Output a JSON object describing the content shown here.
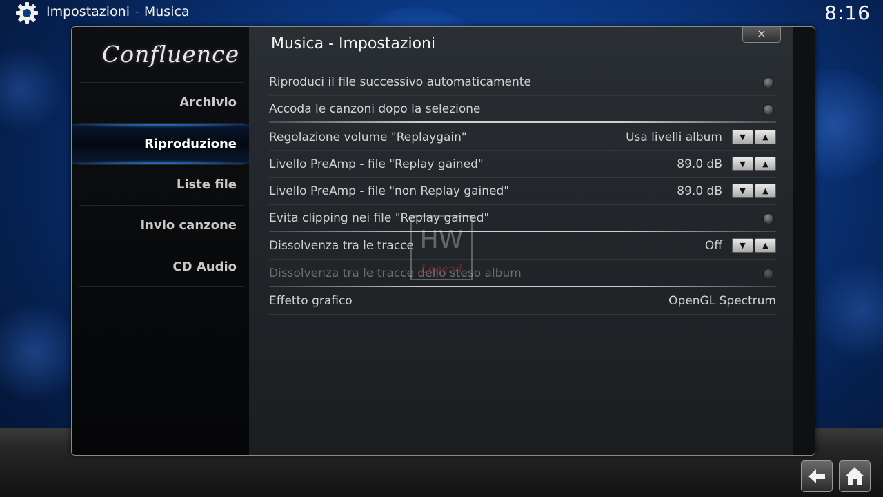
{
  "header": {
    "section": "Impostazioni",
    "separator": "-",
    "subsection": "Musica",
    "clock": "8:16",
    "settings_icon": "gear-icon"
  },
  "sidebar": {
    "logo": "Confluence",
    "items": [
      {
        "label": "Archivio",
        "active": false
      },
      {
        "label": "Riproduzione",
        "active": true
      },
      {
        "label": "Liste file",
        "active": false
      },
      {
        "label": "Invio canzone",
        "active": false
      },
      {
        "label": "CD Audio",
        "active": false
      }
    ]
  },
  "dialog": {
    "title": "Musica - Impostazioni",
    "close_label": "×"
  },
  "settings": [
    {
      "label": "Riproduci il file successivo automaticamente",
      "type": "toggle",
      "value": "",
      "enabled": true
    },
    {
      "label": "Accoda le canzoni dopo la selezione",
      "type": "toggle",
      "value": "",
      "enabled": true
    },
    {
      "label": "Regolazione volume \"Replaygain\"",
      "type": "spinner",
      "value": "Usa livelli album",
      "enabled": true
    },
    {
      "label": "Livello PreAmp - file \"Replay gained\"",
      "type": "spinner",
      "value": "89.0 dB",
      "enabled": true
    },
    {
      "label": "Livello PreAmp - file \"non Replay gained\"",
      "type": "spinner",
      "value": "89.0 dB",
      "enabled": true
    },
    {
      "label": "Evita clipping nei file \"Replay gained\"",
      "type": "toggle",
      "value": "",
      "enabled": true
    },
    {
      "label": "Dissolvenza tra le tracce",
      "type": "spinner",
      "value": "Off",
      "enabled": true
    },
    {
      "label": "Dissolvenza tra le tracce dello steso album",
      "type": "toggle",
      "value": "",
      "enabled": false
    },
    {
      "label": "Effetto grafico",
      "type": "value",
      "value": "OpenGL Spectrum",
      "enabled": true
    }
  ],
  "spinner": {
    "down": "▼",
    "up": "▲"
  },
  "watermark": {
    "text": "HW",
    "subtext": "Legend"
  },
  "nav": {
    "back_icon": "back-arrow-icon",
    "home_icon": "home-icon"
  },
  "colors": {
    "accent": "#4aa3ff",
    "background": "#0b3a86"
  }
}
